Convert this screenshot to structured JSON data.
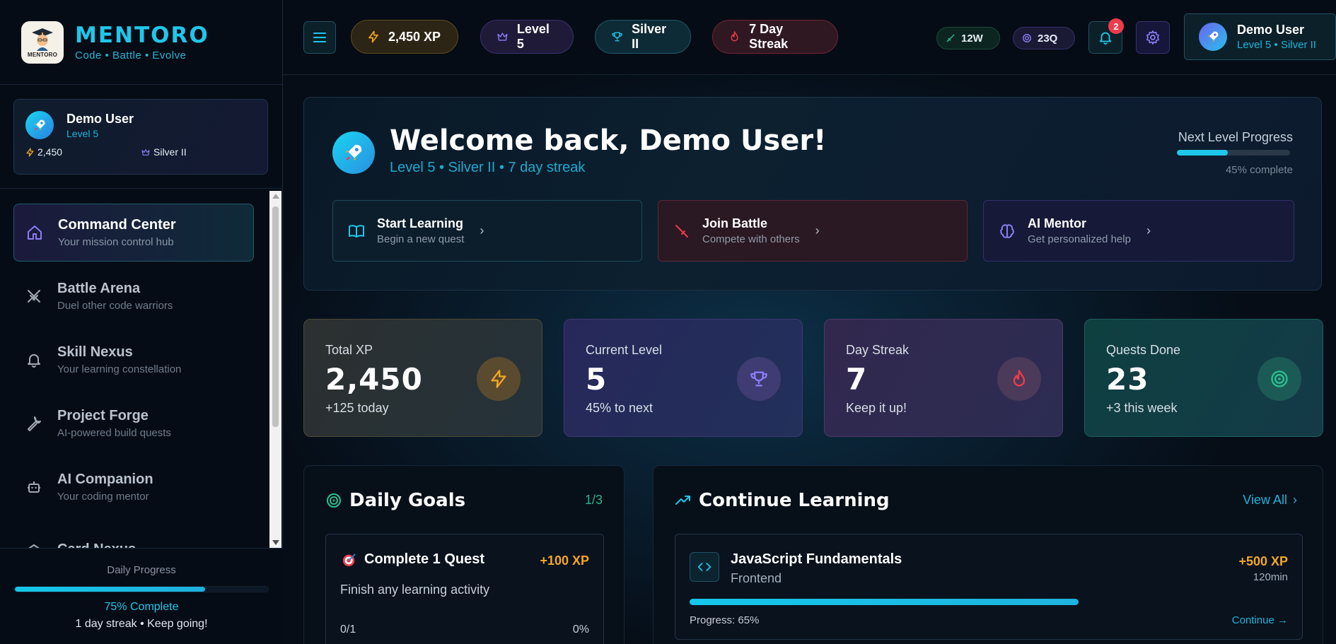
{
  "brand": {
    "logo_text": "MENTORO",
    "name": "MENTORO",
    "tagline": "Code • Battle • Evolve"
  },
  "sidebar_user": {
    "name": "Demo User",
    "level": "Level 5",
    "xp": "2,450",
    "rank": "Silver II"
  },
  "nav": {
    "items": [
      {
        "title": "Command Center",
        "sub": "Your mission control hub",
        "icon": "home-icon",
        "active": true
      },
      {
        "title": "Battle Arena",
        "sub": "Duel other code warriors",
        "icon": "swords-icon"
      },
      {
        "title": "Skill Nexus",
        "sub": "Your learning constellation",
        "icon": "bell-icon"
      },
      {
        "title": "Project Forge",
        "sub": "AI-powered build quests",
        "icon": "wrench-icon"
      },
      {
        "title": "AI Companion",
        "sub": "Your coding mentor",
        "icon": "robot-icon"
      },
      {
        "title": "Card Nexus",
        "sub": "",
        "icon": "cards-icon"
      }
    ]
  },
  "daily_progress": {
    "label": "Daily Progress",
    "percent": 75,
    "percent_label": "75% Complete",
    "streak_text": "1 day streak • Keep going!"
  },
  "topbar": {
    "xp": "2,450 XP",
    "level": "Level 5",
    "rank": "Silver II",
    "streak": "7 Day Streak",
    "wins": "12W",
    "quests": "23Q",
    "notifications": "2",
    "profile_name": "Demo User",
    "profile_sub": "Level 5 • Silver II"
  },
  "welcome": {
    "title": "Welcome back, Demo User!",
    "subtitle": "Level 5 • Silver II • 7 day streak",
    "next_level_label": "Next Level Progress",
    "next_level_percent": 45,
    "next_level_text": "45% complete",
    "actions": [
      {
        "title": "Start Learning",
        "sub": "Begin a new quest",
        "icon": "book-icon"
      },
      {
        "title": "Join Battle",
        "sub": "Compete with others",
        "icon": "sword-icon"
      },
      {
        "title": "AI Mentor",
        "sub": "Get personalized help",
        "icon": "brain-icon"
      }
    ]
  },
  "stats": [
    {
      "label": "Total XP",
      "value": "2,450",
      "sub": "+125 today",
      "icon": "lightning-icon"
    },
    {
      "label": "Current Level",
      "value": "5",
      "sub": "45% to next",
      "icon": "trophy-icon"
    },
    {
      "label": "Day Streak",
      "value": "7",
      "sub": "Keep it up!",
      "icon": "flame-icon"
    },
    {
      "label": "Quests Done",
      "value": "23",
      "sub": "+3 this week",
      "icon": "target-icon"
    }
  ],
  "daily_goals": {
    "title": "Daily Goals",
    "count": "1/3",
    "goal": {
      "title": "Complete 1 Quest",
      "xp": "+100 XP",
      "desc": "Finish any learning activity",
      "progress": "0/1",
      "percent": "0%"
    }
  },
  "continue_learning": {
    "title": "Continue Learning",
    "view_all": "View All",
    "course": {
      "title": "JavaScript Fundamentals",
      "category": "Frontend",
      "xp": "+500 XP",
      "duration": "120min",
      "percent": 65,
      "progress_label": "Progress: 65%",
      "continue_label": "Continue →"
    }
  },
  "colors": {
    "accent": "#1fc7ea",
    "xp_gold": "#f5a623",
    "streak_red": "#ef3b4c",
    "level_purple": "#7b6cf6",
    "quest_green": "#29c28f"
  }
}
